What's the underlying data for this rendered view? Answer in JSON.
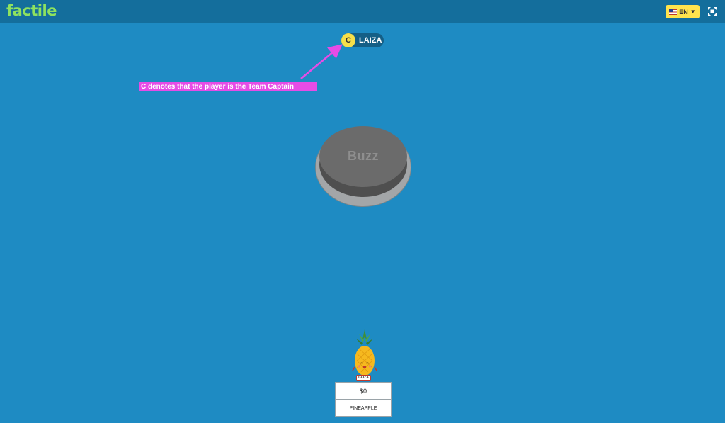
{
  "header": {
    "logo": "factile",
    "language": {
      "flag_icon": "us-flag-icon",
      "code": "EN",
      "chevron_icon": "chevron-down-icon"
    },
    "fullscreen_icon": "fullscreen-icon"
  },
  "player": {
    "captain_badge": "C",
    "name": "LAIZA"
  },
  "annotation": {
    "text": "C denotes that the player is the Team Captain"
  },
  "buzzer": {
    "label": "Buzz"
  },
  "team": {
    "avatar_icon": "pineapple-avatar-icon",
    "member_tag": "LAIZA",
    "score": "$0",
    "name": "PINEAPPLE"
  },
  "colors": {
    "background": "#1e8bc3",
    "topbar": "#146e9c",
    "logo": "#8ee25f",
    "language_button": "#ffe44d",
    "captain_badge": "#f7e04a",
    "annotation": "#e64ce6",
    "buzzer_top": "#6b6b6b",
    "buzzer_ring": "#a3a6a8"
  }
}
